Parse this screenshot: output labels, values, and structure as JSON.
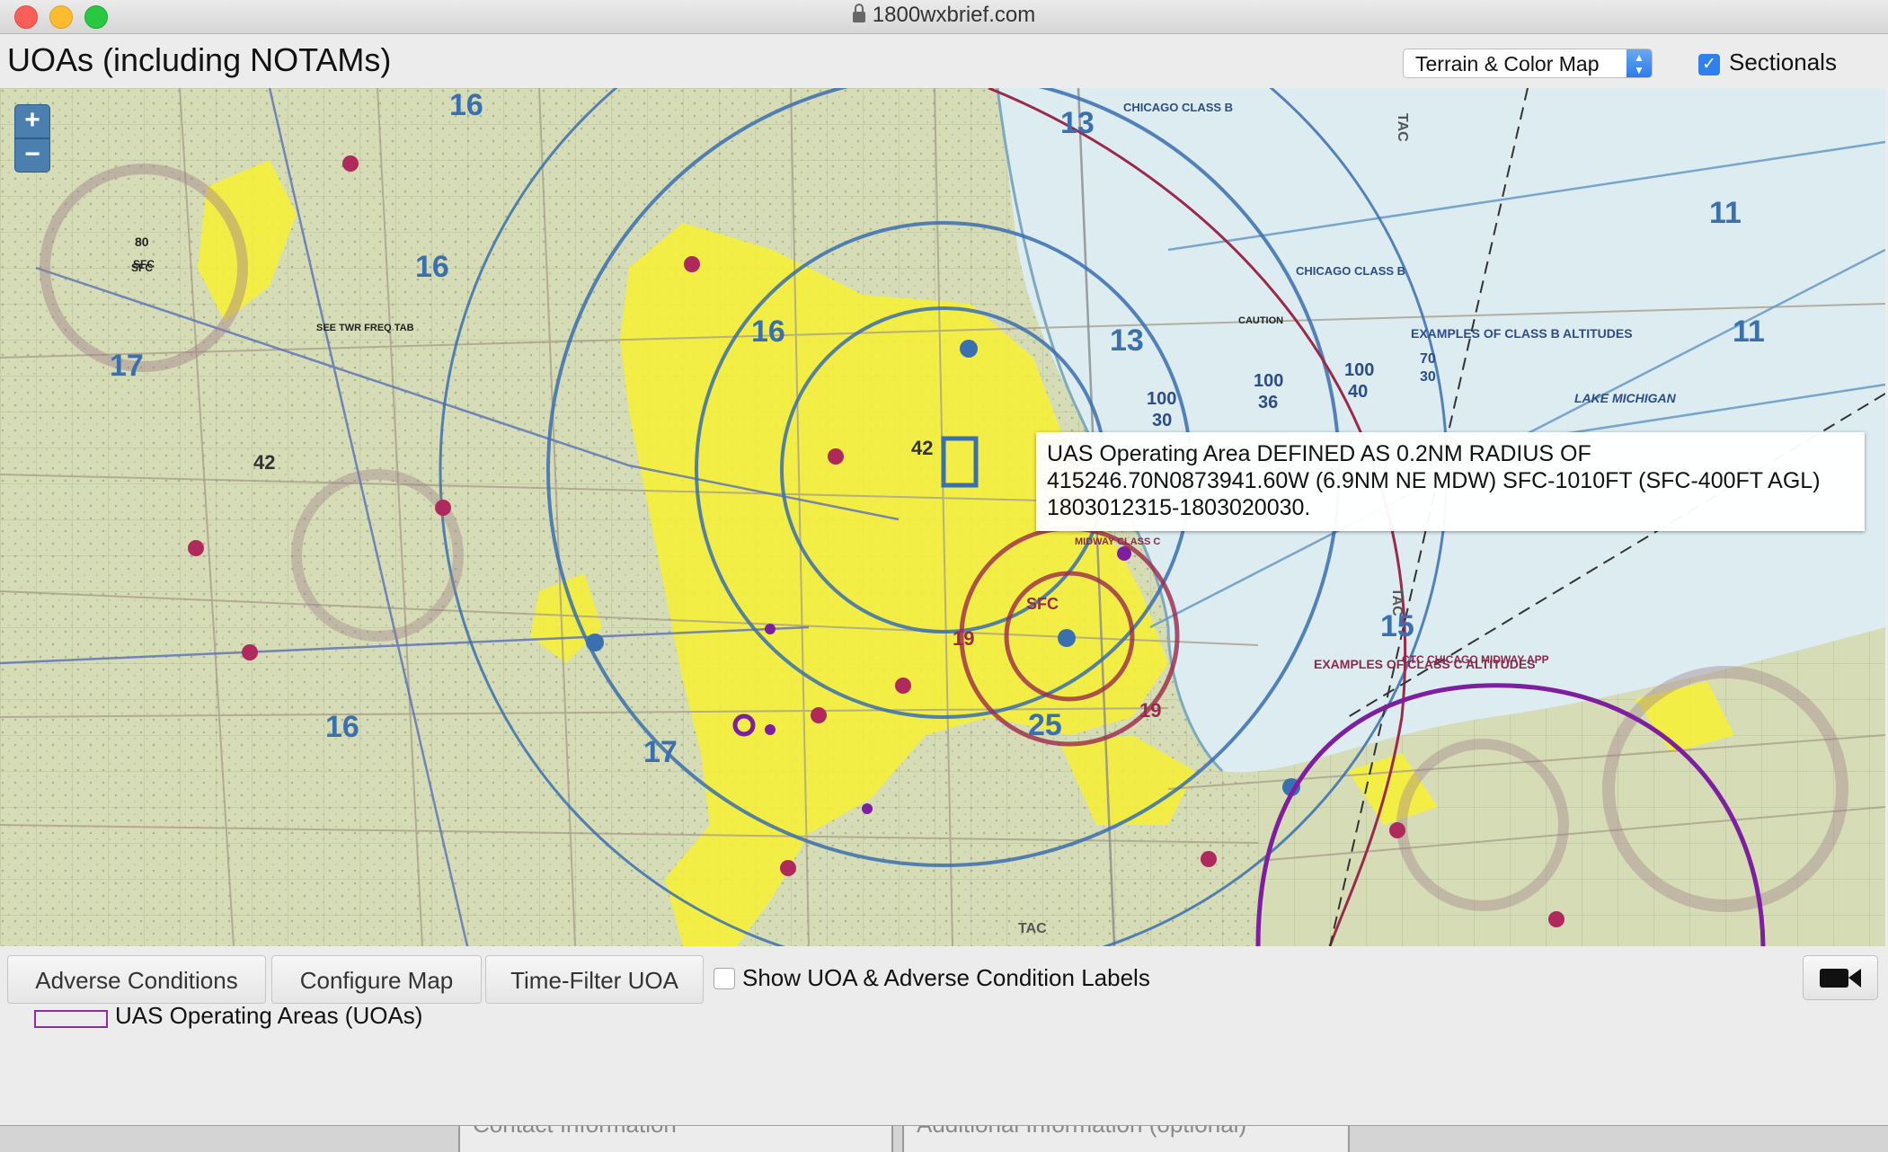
{
  "browser": {
    "url": "1800wxbrief.com"
  },
  "header": {
    "title": "UOAs (including NOTAMs)",
    "map_type_select": {
      "value": "Terrain & Color Map"
    },
    "sectionals": {
      "label": "Sectionals",
      "checked": true
    }
  },
  "map": {
    "zoom_in_label": "+",
    "zoom_out_label": "−",
    "tooltip": "UAS Operating Area DEFINED AS 0.2NM RADIUS OF 415246.70N0873941.60W (6.9NM NE MDW) SFC-1010FT (SFC-400FT AGL) 1803012315-1803020030.",
    "labels": {
      "chicago_class_b": "CHICAGO CLASS B",
      "chicago_class_b_2": "CHICAGO CLASS B",
      "examples_b": "EXAMPLES OF CLASS B ALTITUDES",
      "examples_c": "EXAMPLES OF CLASS C ALTITUDES",
      "lake": "LAKE MICHIGAN",
      "midway": "MIDWAY CLASS C",
      "sfc": "SFC",
      "sfc_nw": "SFC",
      "tac": "TAC",
      "tac_2": "TAC",
      "tac_3": "TAC",
      "num_11": "11",
      "num_11b": "11",
      "num_13": "13",
      "num_13b": "13",
      "num_15": "15",
      "num_16": "16",
      "num_16b": "16",
      "num_16c": "16",
      "num_16d": "16",
      "num_17": "17",
      "num_17b": "17",
      "num_19": "19",
      "num_19b": "19",
      "num_25": "25",
      "num_42": "42",
      "num_42b": "42",
      "alt_100_36": "100",
      "alt_36": "36",
      "alt_100_40": "100",
      "alt_40": "40",
      "alt_100_30": "100",
      "alt_30": "30",
      "alt_70": "70",
      "alt_30b": "30",
      "alt_80": "80",
      "alt_sfc": "SFC",
      "see_twr": "SEE TWR FREQ TAB",
      "caution": "CAUTION",
      "approach": "CTC CHICAGO MIDWAY APP"
    },
    "uoa_color": "#8e2aa6",
    "class_b_color": "#3a6fb0",
    "class_c_color": "#9b2a4a",
    "urban_color": "#f5ef3a",
    "water_color": "#dcecf1"
  },
  "toolbar": {
    "adverse_conditions": "Adverse Conditions",
    "configure_map": "Configure Map",
    "time_filter": "Time-Filter UOA",
    "show_labels": "Show UOA & Adverse Condition Labels",
    "legend_label": "UAS Operating Areas (UOAs)"
  },
  "background_page": {
    "left_heading": "Contact Information",
    "right_heading": "Additional Information (optional)"
  }
}
